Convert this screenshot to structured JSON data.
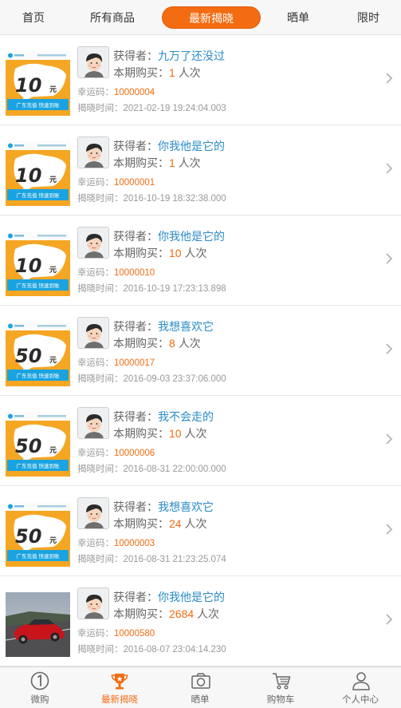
{
  "top_tabs": [
    {
      "label": "首页"
    },
    {
      "label": "所有商品"
    },
    {
      "label": "最新揭晓",
      "active": true
    },
    {
      "label": "晒单"
    },
    {
      "label": "限时"
    }
  ],
  "labels": {
    "winner": "获得者：",
    "bought": "本期购买：",
    "bought_unit": "人次",
    "lucky": "幸运码：",
    "time": "揭晓时间："
  },
  "items": [
    {
      "product_icon": "mobile-recharge-10-yuan-card",
      "price_badge": "10",
      "price_unit": "元",
      "product_text": "广东充值 快速到账",
      "winner": "九万了还没过",
      "bought": "1",
      "lucky_code": "10000004",
      "reveal_time": "2021-02-19 19:24:04.003"
    },
    {
      "product_icon": "mobile-recharge-10-yuan-card",
      "price_badge": "10",
      "price_unit": "元",
      "product_text": "广东充值 快速到账",
      "winner": "你我他是它的",
      "bought": "1",
      "lucky_code": "10000001",
      "reveal_time": "2016-10-19 18:32:38.000"
    },
    {
      "product_icon": "mobile-recharge-10-yuan-card",
      "price_badge": "10",
      "price_unit": "元",
      "product_text": "广东充值 快速到账",
      "winner": "你我他是它的",
      "bought": "10",
      "lucky_code": "10000010",
      "reveal_time": "2016-10-19 17:23:13.898"
    },
    {
      "product_icon": "mobile-recharge-50-yuan-card",
      "price_badge": "50",
      "price_unit": "元",
      "product_text": "广东充值 快速到账",
      "winner": "我想喜欢它",
      "bought": "8",
      "lucky_code": "10000017",
      "reveal_time": "2016-09-03 23:37:06.000"
    },
    {
      "product_icon": "mobile-recharge-50-yuan-card",
      "price_badge": "50",
      "price_unit": "元",
      "product_text": "广东充值 快速到账",
      "winner": "我不会走的",
      "bought": "10",
      "lucky_code": "10000006",
      "reveal_time": "2016-08-31 22:00:00.000"
    },
    {
      "product_icon": "mobile-recharge-50-yuan-card",
      "price_badge": "50",
      "price_unit": "元",
      "product_text": "广东充值 快速到账",
      "winner": "我想喜欢它",
      "bought": "24",
      "lucky_code": "10000003",
      "reveal_time": "2016-08-31 21:23:25.074"
    },
    {
      "product_icon": "red-car-photo",
      "winner": "你我他是它的",
      "bought": "2684",
      "lucky_code": "10000580",
      "reveal_time": "2016-08-07 23:04:14.230"
    }
  ],
  "bottom_nav": [
    {
      "label": "微购",
      "icon": "one-coin-icon"
    },
    {
      "label": "最新揭晓",
      "icon": "trophy-icon",
      "active": true
    },
    {
      "label": "晒单",
      "icon": "camera-icon"
    },
    {
      "label": "购物车",
      "icon": "cart-icon"
    },
    {
      "label": "个人中心",
      "icon": "person-icon"
    }
  ],
  "colors": {
    "accent": "#f36c12",
    "winner_blue": "#2a8cc8",
    "badge_orange": "#f5a623",
    "badge_blue": "#1aa3e0"
  }
}
